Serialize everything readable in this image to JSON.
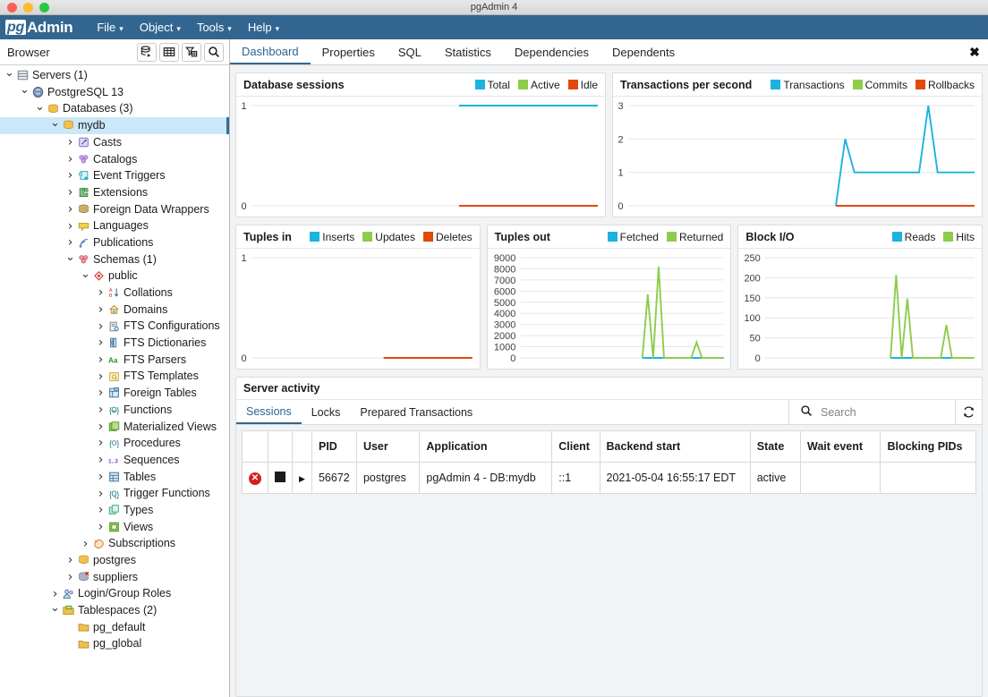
{
  "window": {
    "title": "pgAdmin 4"
  },
  "menubar": {
    "brand_pg": "pg",
    "brand_admin": "Admin",
    "items": [
      {
        "label": "File",
        "caret": "⌄"
      },
      {
        "label": "Object",
        "caret": "⌄"
      },
      {
        "label": "Tools",
        "caret": "⌄"
      },
      {
        "label": "Help",
        "caret": "⌄"
      }
    ]
  },
  "browser": {
    "title": "Browser",
    "tools": [
      {
        "name": "query-tool-icon",
        "title": "Query Tool"
      },
      {
        "name": "view-data-icon",
        "title": "View Data"
      },
      {
        "name": "filtered-rows-icon",
        "title": "Filtered Rows"
      },
      {
        "name": "search-objects-icon",
        "title": "Search objects"
      }
    ],
    "tree": [
      {
        "label": "Servers (1)",
        "depth": 0,
        "state": "open",
        "icon": "servers-icon",
        "selected": false
      },
      {
        "label": "PostgreSQL 13",
        "depth": 1,
        "state": "open",
        "icon": "postgres-icon",
        "selected": false
      },
      {
        "label": "Databases (3)",
        "depth": 2,
        "state": "open",
        "icon": "databases-icon",
        "selected": false
      },
      {
        "label": "mydb",
        "depth": 3,
        "state": "open",
        "icon": "database-icon",
        "selected": true
      },
      {
        "label": "Casts",
        "depth": 4,
        "state": "closed",
        "icon": "casts-icon",
        "selected": false
      },
      {
        "label": "Catalogs",
        "depth": 4,
        "state": "closed",
        "icon": "catalogs-icon",
        "selected": false
      },
      {
        "label": "Event Triggers",
        "depth": 4,
        "state": "closed",
        "icon": "event-triggers-icon",
        "selected": false
      },
      {
        "label": "Extensions",
        "depth": 4,
        "state": "closed",
        "icon": "extensions-icon",
        "selected": false
      },
      {
        "label": "Foreign Data Wrappers",
        "depth": 4,
        "state": "closed",
        "icon": "fdw-icon",
        "selected": false
      },
      {
        "label": "Languages",
        "depth": 4,
        "state": "closed",
        "icon": "languages-icon",
        "selected": false
      },
      {
        "label": "Publications",
        "depth": 4,
        "state": "closed",
        "icon": "publications-icon",
        "selected": false
      },
      {
        "label": "Schemas (1)",
        "depth": 4,
        "state": "open",
        "icon": "schemas-icon",
        "selected": false
      },
      {
        "label": "public",
        "depth": 5,
        "state": "open",
        "icon": "schema-icon",
        "selected": false
      },
      {
        "label": "Collations",
        "depth": 6,
        "state": "closed",
        "icon": "collations-icon",
        "selected": false
      },
      {
        "label": "Domains",
        "depth": 6,
        "state": "closed",
        "icon": "domains-icon",
        "selected": false
      },
      {
        "label": "FTS Configurations",
        "depth": 6,
        "state": "closed",
        "icon": "fts-config-icon",
        "selected": false
      },
      {
        "label": "FTS Dictionaries",
        "depth": 6,
        "state": "closed",
        "icon": "fts-dict-icon",
        "selected": false
      },
      {
        "label": "FTS Parsers",
        "depth": 6,
        "state": "closed",
        "icon": "fts-parser-icon",
        "selected": false
      },
      {
        "label": "FTS Templates",
        "depth": 6,
        "state": "closed",
        "icon": "fts-template-icon",
        "selected": false
      },
      {
        "label": "Foreign Tables",
        "depth": 6,
        "state": "closed",
        "icon": "foreign-tables-icon",
        "selected": false
      },
      {
        "label": "Functions",
        "depth": 6,
        "state": "closed",
        "icon": "functions-icon",
        "selected": false
      },
      {
        "label": "Materialized Views",
        "depth": 6,
        "state": "closed",
        "icon": "matviews-icon",
        "selected": false
      },
      {
        "label": "Procedures",
        "depth": 6,
        "state": "closed",
        "icon": "procedures-icon",
        "selected": false
      },
      {
        "label": "Sequences",
        "depth": 6,
        "state": "closed",
        "icon": "sequences-icon",
        "selected": false
      },
      {
        "label": "Tables",
        "depth": 6,
        "state": "closed",
        "icon": "tables-icon",
        "selected": false
      },
      {
        "label": "Trigger Functions",
        "depth": 6,
        "state": "closed",
        "icon": "trigger-func-icon",
        "selected": false
      },
      {
        "label": "Types",
        "depth": 6,
        "state": "closed",
        "icon": "types-icon",
        "selected": false
      },
      {
        "label": "Views",
        "depth": 6,
        "state": "closed",
        "icon": "views-icon",
        "selected": false
      },
      {
        "label": "Subscriptions",
        "depth": 5,
        "state": "closed",
        "icon": "subscriptions-icon",
        "selected": false
      },
      {
        "label": "postgres",
        "depth": 4,
        "state": "closed",
        "icon": "database-icon",
        "selected": false
      },
      {
        "label": "suppliers",
        "depth": 4,
        "state": "closed",
        "icon": "database-disconnected-icon",
        "selected": false
      },
      {
        "label": "Login/Group Roles",
        "depth": 3,
        "state": "closed",
        "icon": "roles-icon",
        "selected": false
      },
      {
        "label": "Tablespaces (2)",
        "depth": 3,
        "state": "open",
        "icon": "tablespaces-icon",
        "selected": false
      },
      {
        "label": "pg_default",
        "depth": 4,
        "state": "leaf",
        "icon": "tablespace-icon",
        "selected": false
      },
      {
        "label": "pg_global",
        "depth": 4,
        "state": "leaf",
        "icon": "tablespace-icon",
        "selected": false
      }
    ]
  },
  "tabs": {
    "items": [
      "Dashboard",
      "Properties",
      "SQL",
      "Statistics",
      "Dependencies",
      "Dependents"
    ],
    "active": "Dashboard",
    "close_icon": "✖"
  },
  "colors": {
    "blue": "#1cb3e0",
    "green": "#8ecc4c",
    "red": "#e14a09",
    "accent": "#326690",
    "grid": "#e4e6e8"
  },
  "chart_data": [
    {
      "id": "database-sessions",
      "type": "line",
      "title": "Database sessions",
      "legend": [
        {
          "name": "Total",
          "color": "#1cb3e0"
        },
        {
          "name": "Active",
          "color": "#8ecc4c"
        },
        {
          "name": "Idle",
          "color": "#e14a09"
        }
      ],
      "ylim": [
        0,
        1
      ],
      "yticks": [
        0,
        1
      ],
      "grid": true,
      "legend_position": "top-right",
      "series": [
        {
          "name": "Total",
          "color": "#1cb3e0",
          "start_frac": 0.6,
          "values": [
            1,
            1,
            1,
            1,
            1,
            1,
            1,
            1
          ]
        },
        {
          "name": "Active",
          "color": "#8ecc4c",
          "start_frac": 0.6,
          "values": [
            0,
            0,
            0,
            0,
            0,
            0,
            0,
            0
          ]
        },
        {
          "name": "Idle",
          "color": "#e14a09",
          "start_frac": 0.6,
          "values": [
            0,
            0,
            0,
            0,
            0,
            0,
            0,
            0
          ]
        }
      ]
    },
    {
      "id": "transactions-per-second",
      "type": "line",
      "title": "Transactions per second",
      "legend": [
        {
          "name": "Transactions",
          "color": "#1cb3e0"
        },
        {
          "name": "Commits",
          "color": "#8ecc4c"
        },
        {
          "name": "Rollbacks",
          "color": "#e14a09"
        }
      ],
      "ylim": [
        0,
        3
      ],
      "yticks": [
        0,
        1,
        2,
        3
      ],
      "grid": true,
      "legend_position": "top-right",
      "series": [
        {
          "name": "Transactions",
          "color": "#1cb3e0",
          "start_frac": 0.6,
          "values": [
            0,
            2,
            1,
            1,
            1,
            1,
            1,
            1,
            1,
            1,
            3,
            1,
            1,
            1,
            1,
            1
          ]
        },
        {
          "name": "Commits",
          "color": "#8ecc4c",
          "start_frac": 0.6,
          "values": [
            0,
            0,
            0,
            0,
            0,
            0,
            0,
            0,
            0,
            0,
            0,
            0,
            0,
            0,
            0,
            0
          ]
        },
        {
          "name": "Rollbacks",
          "color": "#e14a09",
          "start_frac": 0.6,
          "values": [
            0,
            0,
            0,
            0,
            0,
            0,
            0,
            0,
            0,
            0,
            0,
            0,
            0,
            0,
            0,
            0
          ]
        }
      ]
    },
    {
      "id": "tuples-in",
      "type": "line",
      "title": "Tuples in",
      "legend": [
        {
          "name": "Inserts",
          "color": "#1cb3e0"
        },
        {
          "name": "Updates",
          "color": "#8ecc4c"
        },
        {
          "name": "Deletes",
          "color": "#e14a09"
        }
      ],
      "ylim": [
        0,
        1
      ],
      "yticks": [
        0,
        1
      ],
      "grid": true,
      "legend_position": "top-right",
      "series": [
        {
          "name": "Inserts",
          "color": "#1cb3e0",
          "start_frac": 0.6,
          "values": [
            0,
            0,
            0,
            0,
            0,
            0,
            0,
            0
          ]
        },
        {
          "name": "Updates",
          "color": "#8ecc4c",
          "start_frac": 0.6,
          "values": [
            0,
            0,
            0,
            0,
            0,
            0,
            0,
            0
          ]
        },
        {
          "name": "Deletes",
          "color": "#e14a09",
          "start_frac": 0.6,
          "values": [
            0,
            0,
            0,
            0,
            0,
            0,
            0,
            0
          ]
        }
      ]
    },
    {
      "id": "tuples-out",
      "type": "line",
      "title": "Tuples out",
      "legend": [
        {
          "name": "Fetched",
          "color": "#1cb3e0"
        },
        {
          "name": "Returned",
          "color": "#8ecc4c"
        }
      ],
      "ylim": [
        0,
        9000
      ],
      "yticks": [
        0,
        1000,
        2000,
        3000,
        4000,
        5000,
        6000,
        7000,
        8000,
        9000
      ],
      "grid": true,
      "legend_position": "top-right",
      "series": [
        {
          "name": "Fetched",
          "color": "#1cb3e0",
          "start_frac": 0.6,
          "values": [
            0,
            0,
            0,
            0,
            0,
            0,
            0,
            0,
            0,
            0,
            0,
            0,
            0,
            0,
            0,
            0
          ]
        },
        {
          "name": "Returned",
          "color": "#8ecc4c",
          "start_frac": 0.6,
          "values": [
            0,
            5700,
            0,
            8200,
            0,
            0,
            0,
            0,
            0,
            0,
            1400,
            0,
            0,
            0,
            0,
            0
          ]
        }
      ]
    },
    {
      "id": "block-io",
      "type": "line",
      "title": "Block I/O",
      "legend": [
        {
          "name": "Reads",
          "color": "#1cb3e0"
        },
        {
          "name": "Hits",
          "color": "#8ecc4c"
        }
      ],
      "ylim": [
        0,
        250
      ],
      "yticks": [
        0,
        50,
        100,
        150,
        200,
        250
      ],
      "grid": true,
      "legend_position": "top-right",
      "series": [
        {
          "name": "Reads",
          "color": "#1cb3e0",
          "start_frac": 0.6,
          "values": [
            0,
            0,
            0,
            0,
            0,
            0,
            0,
            0,
            0,
            0,
            0,
            0,
            0,
            0,
            0,
            0
          ]
        },
        {
          "name": "Hits",
          "color": "#8ecc4c",
          "start_frac": 0.6,
          "values": [
            0,
            207,
            0,
            148,
            0,
            0,
            0,
            0,
            0,
            0,
            82,
            0,
            0,
            0,
            0,
            0
          ]
        }
      ]
    }
  ],
  "server_activity": {
    "title": "Server activity",
    "tabs": [
      "Sessions",
      "Locks",
      "Prepared Transactions"
    ],
    "active_tab": "Sessions",
    "search": {
      "placeholder": "Search",
      "value": "",
      "icon": "search-icon"
    },
    "refresh_icon": "refresh-icon",
    "columns": [
      "",
      "",
      "",
      "PID",
      "User",
      "Application",
      "Client",
      "Backend start",
      "State",
      "Wait event",
      "Blocking PIDs"
    ],
    "rows": [
      {
        "terminate_icon": "terminate-session-icon",
        "cancel_icon": "cancel-query-icon",
        "expand_icon": "expand-row-icon",
        "pid": "56672",
        "user": "postgres",
        "application": "pgAdmin 4 - DB:mydb",
        "client": "::1",
        "backend_start": "2021-05-04 16:55:17 EDT",
        "state": "active",
        "wait_event": "",
        "blocking_pids": ""
      }
    ]
  }
}
